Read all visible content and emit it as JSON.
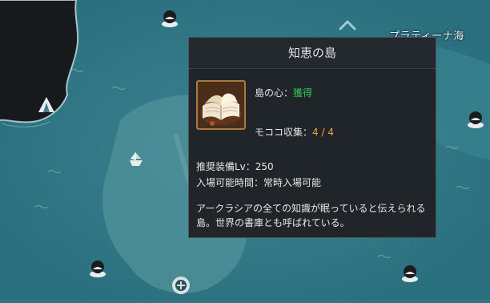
{
  "map": {
    "region_label": "プラティーナ海",
    "colors": {
      "sea_deep": "#2e7684",
      "sea_shallow": "#4a8c96",
      "land": "#171a1c",
      "shore": "#c7e1e3"
    },
    "icons": [
      "island-icon",
      "island-icon",
      "island-icon",
      "island-icon",
      "camp-tent-icon",
      "ship-icon",
      "chevron-up-icon",
      "ruins-icon"
    ]
  },
  "tooltip": {
    "title": "知恵の島",
    "thumbnail_icon": "open-book-icon",
    "heart_label": "島の心：",
    "heart_value": "獲得",
    "mokoko_label": "モココ収集：",
    "mokoko_value": "4 / 4",
    "recommended_level": "推奨装備Lv：250",
    "entry_time": "入場可能時間：常時入場可能",
    "description": "アークラシアの全ての知識が眠っていると伝えられる島。世界の書庫とも呼ばれている。",
    "colors": {
      "background": "#20252a",
      "border": "#4e565d",
      "acquired": "#35c95a",
      "count": "#e8a53a"
    }
  }
}
